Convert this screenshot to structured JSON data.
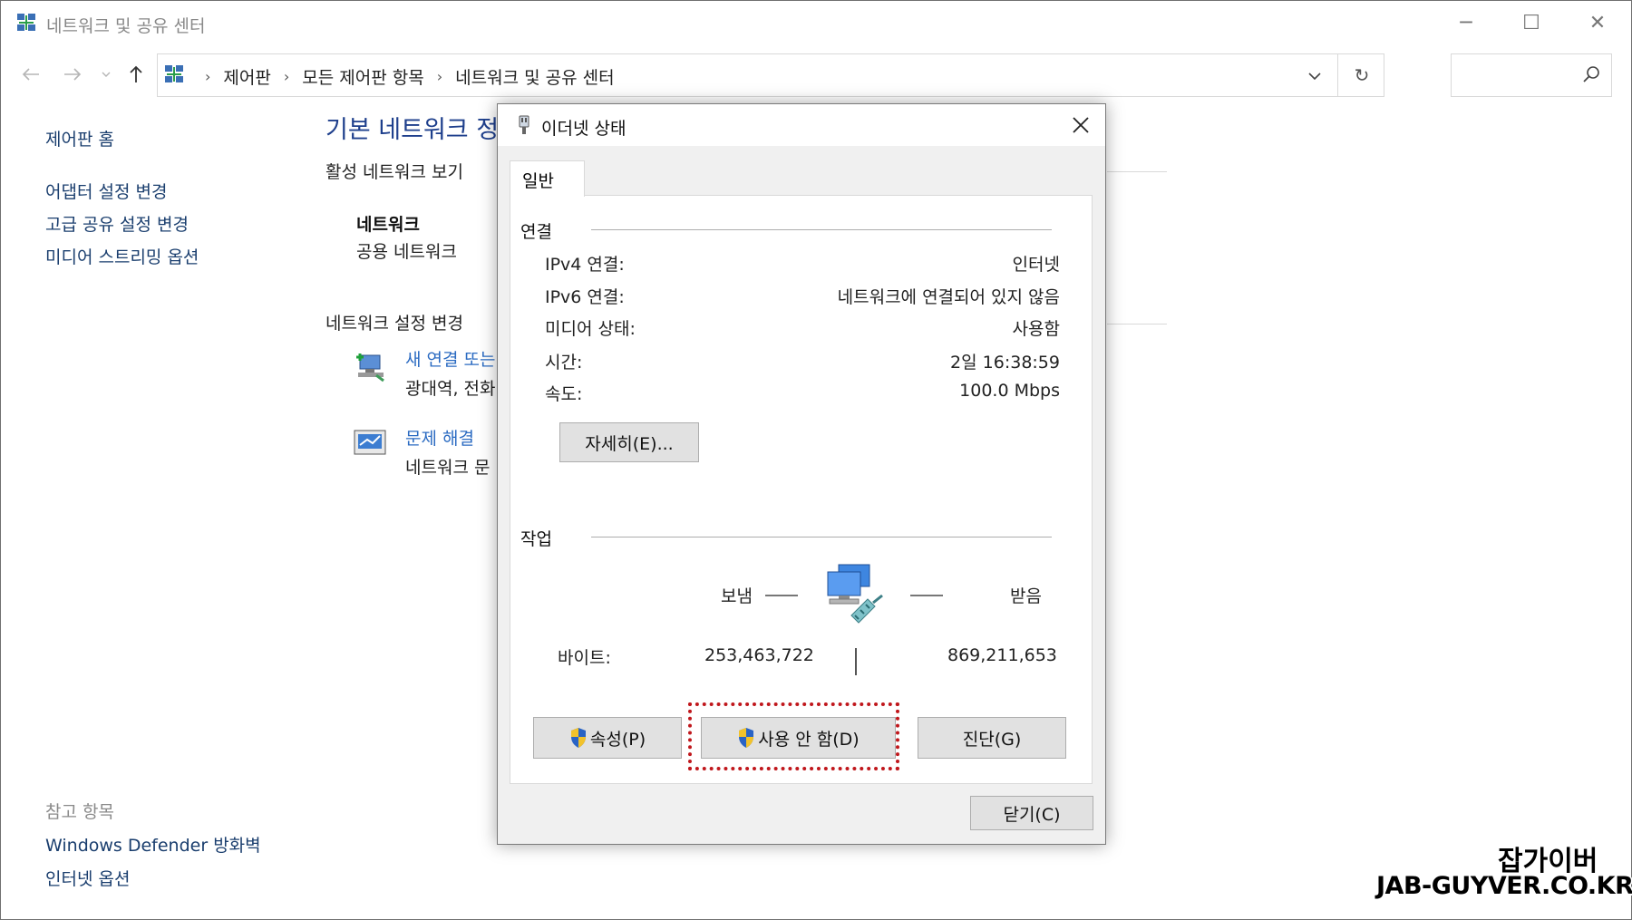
{
  "window": {
    "title": "네트워크 및 공유 센터",
    "controls": {
      "minimize": "─",
      "maximize": "☐",
      "close": "✕"
    }
  },
  "navigation": {
    "breadcrumbs": [
      "제어판",
      "모든 제어판 항목",
      "네트워크 및 공유 센터"
    ],
    "separator": "›",
    "refresh_glyph": "↻",
    "search_placeholder": ""
  },
  "left_pane": {
    "home": "제어판 홈",
    "links": [
      "어댑터 설정 변경",
      "고급 공유 설정 변경",
      "미디어 스트리밍 옵션"
    ],
    "see_also_label": "참고 항목",
    "see_also": [
      "Windows Defender 방화벽",
      "인터넷 옵션"
    ]
  },
  "main_pane": {
    "title": "기본 네트워크 정",
    "active_networks_label": "활성 네트워크 보기",
    "network_name": "네트워크",
    "network_type": "공용 네트워크",
    "change_settings_label": "네트워크 설정 변경",
    "tasks": [
      {
        "link": "새 연결 또는",
        "desc": "광대역, 전화",
        "icon": "new-connection-icon"
      },
      {
        "link": "문제 해결",
        "desc": "네트워크 문",
        "icon": "troubleshoot-icon"
      }
    ]
  },
  "dialog": {
    "title": "이더넷 상태",
    "close_glyph": "✕",
    "tab": "일반",
    "connection_group": "연결",
    "fields": [
      {
        "label": "IPv4 연결:",
        "value": "인터넷"
      },
      {
        "label": "IPv6 연결:",
        "value": "네트워크에 연결되어 있지 않음"
      },
      {
        "label": "미디어 상태:",
        "value": "사용함"
      },
      {
        "label": "시간:",
        "value": "2일 16:38:59"
      },
      {
        "label": "속도:",
        "value": "100.0 Mbps"
      }
    ],
    "details_button": "자세히(E)...",
    "activity_group": "작업",
    "sent_label": "보냄",
    "received_label": "받음",
    "bytes_label": "바이트:",
    "bytes_sent": "253,463,722",
    "bytes_received": "869,211,653",
    "properties_button": "속성(P)",
    "disable_button": "사용 안 함(D)",
    "diagnose_button": "진단(G)",
    "close_button": "닫기(C)",
    "highlight_color": "#c0171c"
  },
  "watermark": {
    "line1": "잡가이버",
    "line2": "JAB-GUYVER.CO.KR"
  },
  "colors": {
    "link": "#1a3e6e",
    "task_link": "#2b6bc2",
    "heading": "#1e3f8c",
    "button_face": "#e1e1e1",
    "dialog_bg": "#f0f0f0"
  }
}
